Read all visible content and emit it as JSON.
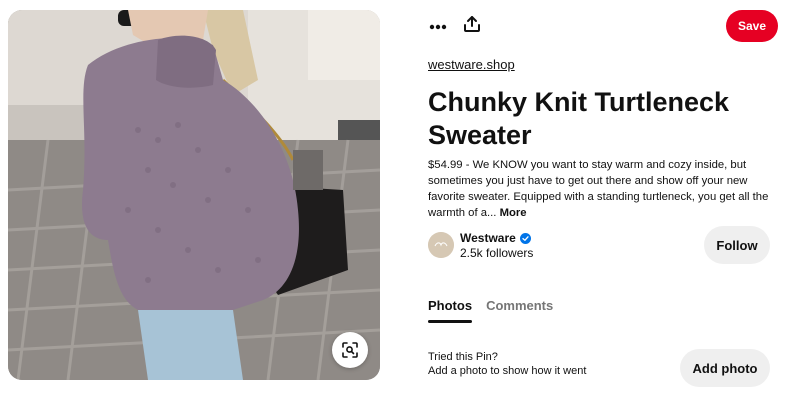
{
  "pin_image": {
    "alt": "",
    "visual_search_icon": "visual-search-icon"
  },
  "toolbar": {
    "more_icon": "ellipsis-icon",
    "share_icon": "share-icon",
    "save_label": "Save"
  },
  "pin": {
    "source": "westware.shop",
    "title": "Chunky Knit Turtleneck Sweater",
    "description": "$54.99 - We KNOW you want to stay warm and cozy inside, but sometimes you just have to get out there and show off your new favorite sweater. Equipped with a standing turtleneck, you get all the warmth of a...",
    "more_label": "More"
  },
  "creator": {
    "name": "Westware",
    "followers": "2.5k followers",
    "verified_icon": "verified-check-icon",
    "follow_label": "Follow"
  },
  "tabs": [
    {
      "label": "Photos",
      "active": true
    },
    {
      "label": "Comments",
      "active": false
    }
  ],
  "tried": {
    "heading": "Tried this Pin?",
    "subtext": "Add a photo to show how it went",
    "button_label": "Add photo"
  },
  "colors": {
    "save_red": "#e60023",
    "button_gray": "#efefef",
    "verified_blue": "#0074e8"
  }
}
